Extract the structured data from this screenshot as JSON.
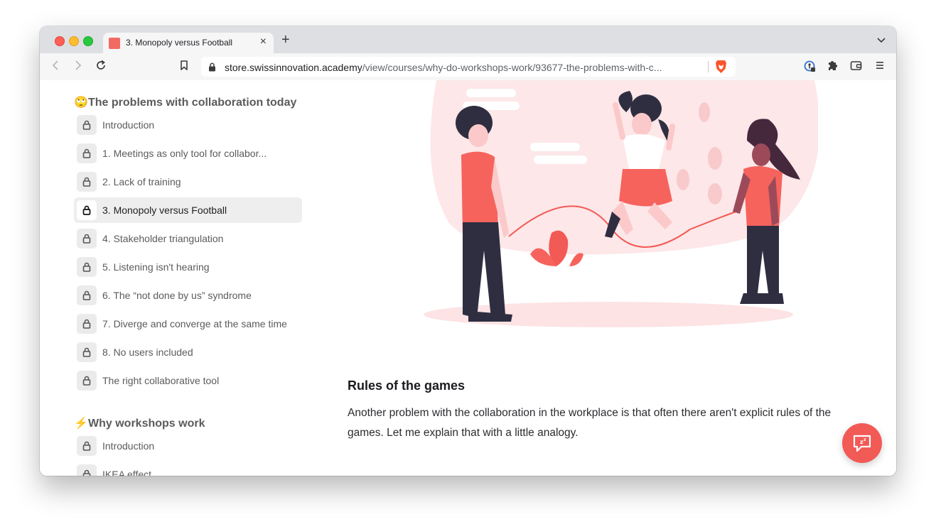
{
  "browser": {
    "tab_title": "3. Monopoly versus Football",
    "url_host": "store.swissinnovation.academy",
    "url_path": "/view/courses/why-do-workshops-work/93677-the-problems-with-c..."
  },
  "sidebar": {
    "sections": [
      {
        "emoji": "🙄",
        "title": "The problems with collaboration today",
        "lessons": [
          {
            "label": "Introduction",
            "active": false
          },
          {
            "label": "1. Meetings as only tool for collabor...",
            "active": false
          },
          {
            "label": "2. Lack of training",
            "active": false
          },
          {
            "label": "3. Monopoly versus Football",
            "active": true
          },
          {
            "label": "4. Stakeholder triangulation",
            "active": false
          },
          {
            "label": "5. Listening isn't hearing",
            "active": false
          },
          {
            "label": "6. The “not done by us” syndrome",
            "active": false
          },
          {
            "label": "7. Diverge and converge at the same time",
            "active": false
          },
          {
            "label": "8. No users included",
            "active": false
          },
          {
            "label": "The right collaborative tool",
            "active": false
          }
        ]
      },
      {
        "emoji": "⚡",
        "title": "Why workshops work",
        "lessons": [
          {
            "label": "Introduction",
            "active": false
          },
          {
            "label": "IKEA effect",
            "active": false
          }
        ]
      }
    ]
  },
  "main": {
    "heading": "Rules of the games",
    "paragraph": "Another problem with the collaboration in the workplace is that often there aren't explicit rules of the games. Let me explain that with a little analogy."
  },
  "colors": {
    "accent": "#f25a56",
    "illustration_pink": "#fde7e8",
    "shirt_red": "#f6635d",
    "dark": "#2f2e41"
  },
  "icons": [
    "back-icon",
    "forward-icon",
    "reload-icon",
    "bookmark-icon",
    "lock-icon",
    "brave-lion-icon",
    "password-key-icon",
    "extensions-puzzle-icon",
    "wallet-icon",
    "menu-icon",
    "chat-icon"
  ]
}
